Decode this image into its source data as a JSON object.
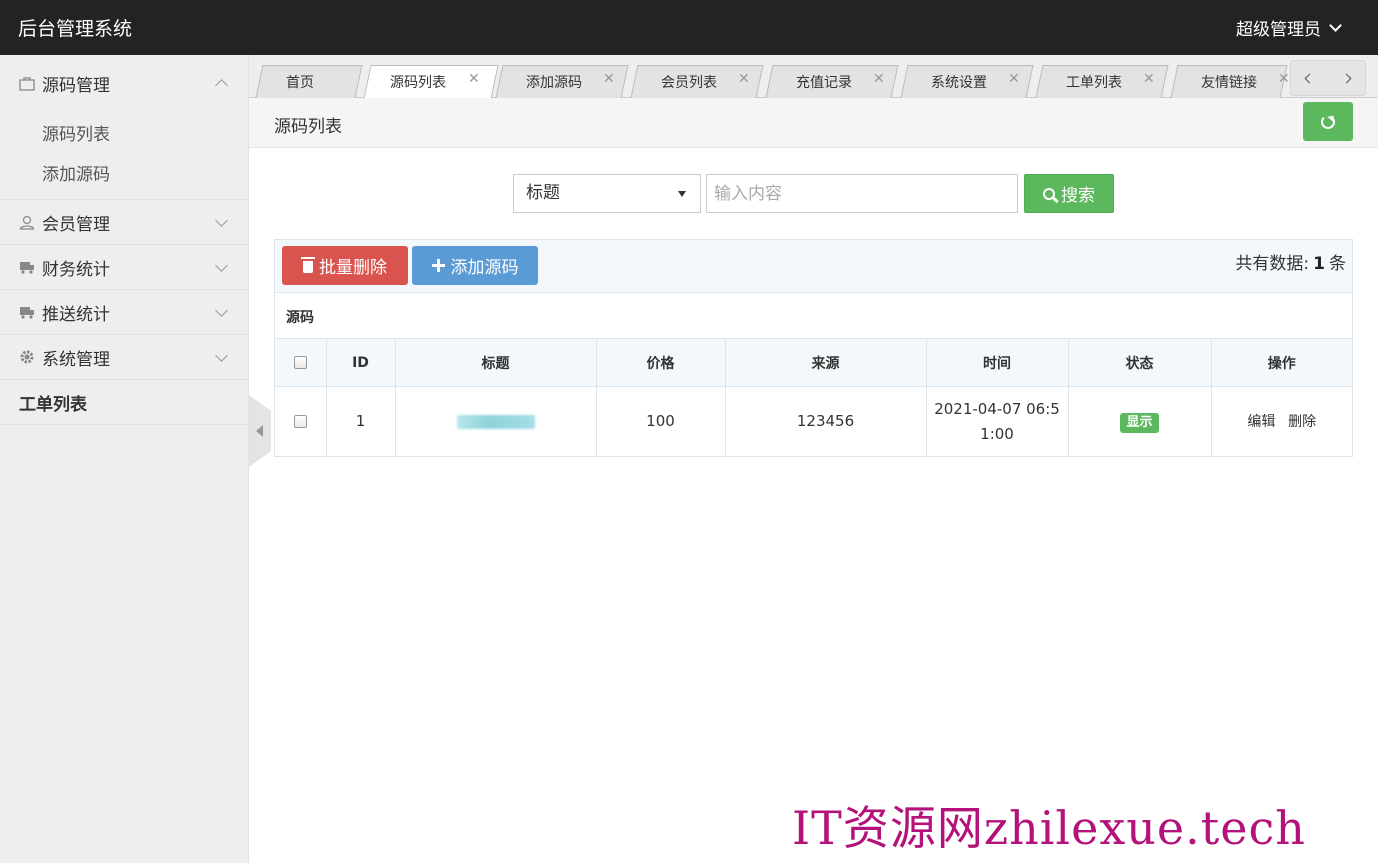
{
  "header": {
    "title": "后台管理系统",
    "user": "超级管理员"
  },
  "sidebar": {
    "groups": [
      {
        "label": "源码管理",
        "icon": "bag-icon",
        "expanded": true,
        "items": [
          "源码列表",
          "添加源码"
        ]
      },
      {
        "label": "会员管理",
        "icon": "user-icon",
        "expanded": false
      },
      {
        "label": "财务统计",
        "icon": "truck-icon",
        "expanded": false
      },
      {
        "label": "推送统计",
        "icon": "truck-icon",
        "expanded": false
      },
      {
        "label": "系统管理",
        "icon": "gear-icon",
        "expanded": false
      },
      {
        "label": "工单列表"
      }
    ]
  },
  "tabs": [
    {
      "label": "首页",
      "closable": false
    },
    {
      "label": "源码列表",
      "closable": true,
      "active": true
    },
    {
      "label": "添加源码",
      "closable": true
    },
    {
      "label": "会员列表",
      "closable": true
    },
    {
      "label": "充值记录",
      "closable": true
    },
    {
      "label": "系统设置",
      "closable": true
    },
    {
      "label": "工单列表",
      "closable": true
    },
    {
      "label": "友情链接",
      "closable": true
    }
  ],
  "page": {
    "title": "源码列表"
  },
  "search": {
    "field": "标题",
    "placeholder": "输入内容",
    "button": "搜索"
  },
  "toolbar": {
    "batch_delete": "批量删除",
    "add": "添加源码",
    "total_prefix": "共有数据:",
    "total_count": "1",
    "total_suffix": "条"
  },
  "table": {
    "caption": "源码",
    "columns": [
      "ID",
      "标题",
      "价格",
      "来源",
      "时间",
      "状态",
      "操作"
    ],
    "rows": [
      {
        "id": "1",
        "title": "",
        "price": "100",
        "source": "123456",
        "time_line1": "2021-04-07 06:5",
        "time_line2": "1:00",
        "status": "显示",
        "edit": "编辑",
        "delete": "删除"
      }
    ]
  },
  "colors": {
    "header_bg": "#232323",
    "success": "#5cb85c",
    "danger": "#d9534f",
    "primary": "#5b9bd5",
    "watermark": "#b4127a"
  },
  "watermark": "IT资源网zhilexue.tech"
}
